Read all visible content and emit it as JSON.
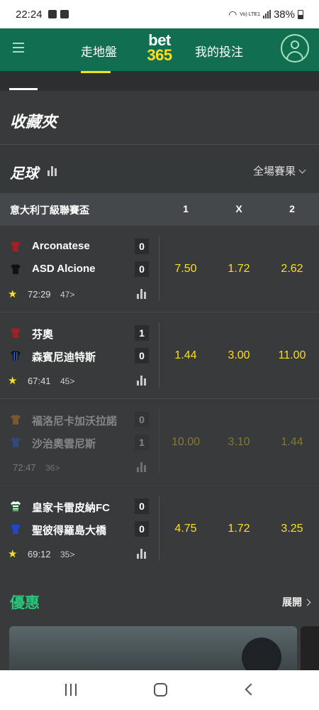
{
  "status_bar": {
    "time": "22:24",
    "network": "Vo) LTE1",
    "battery": "38%"
  },
  "top_nav": {
    "live_label": "走地盤",
    "logo_line1": "bet",
    "logo_line2": "365",
    "my_bets_label": "我的投注"
  },
  "favorites": {
    "title": "收藏夾"
  },
  "sport": {
    "title": "足球",
    "filter_label": "全場賽果"
  },
  "league": {
    "name": "意大利丁級聯賽盃",
    "columns": [
      "1",
      "X",
      "2"
    ]
  },
  "matches": [
    {
      "home": "Arconatese",
      "away": "ASD Alcione",
      "home_score": "0",
      "away_score": "0",
      "odds": [
        "7.50",
        "1.72",
        "2.62"
      ],
      "time": "72:29",
      "markets": "47",
      "favorite": true,
      "suspended": false
    },
    {
      "home": "芬奧",
      "away": "森賓尼迪特斯",
      "home_score": "1",
      "away_score": "0",
      "odds": [
        "1.44",
        "3.00",
        "11.00"
      ],
      "time": "67:41",
      "markets": "45",
      "favorite": true,
      "suspended": false
    },
    {
      "home": "福洛尼卡加沃拉諾",
      "away": "沙治奧雲尼斯",
      "home_score": "0",
      "away_score": "1",
      "odds": [
        "10.00",
        "3.10",
        "1.44"
      ],
      "time": "72:47",
      "markets": "36",
      "favorite": false,
      "suspended": true
    },
    {
      "home": "皇家卡雷皮納FC",
      "away": "聖彼得羅島大橋",
      "home_score": "0",
      "away_score": "0",
      "odds": [
        "4.75",
        "1.72",
        "3.25"
      ],
      "time": "69:12",
      "markets": "35",
      "favorite": true,
      "suspended": false
    }
  ],
  "promotions": {
    "title": "優惠",
    "expand_label": "展開"
  },
  "colors": {
    "header_green": "#126e51",
    "odds_yellow": "#ffdf1b",
    "promo_green": "#29c67a"
  }
}
